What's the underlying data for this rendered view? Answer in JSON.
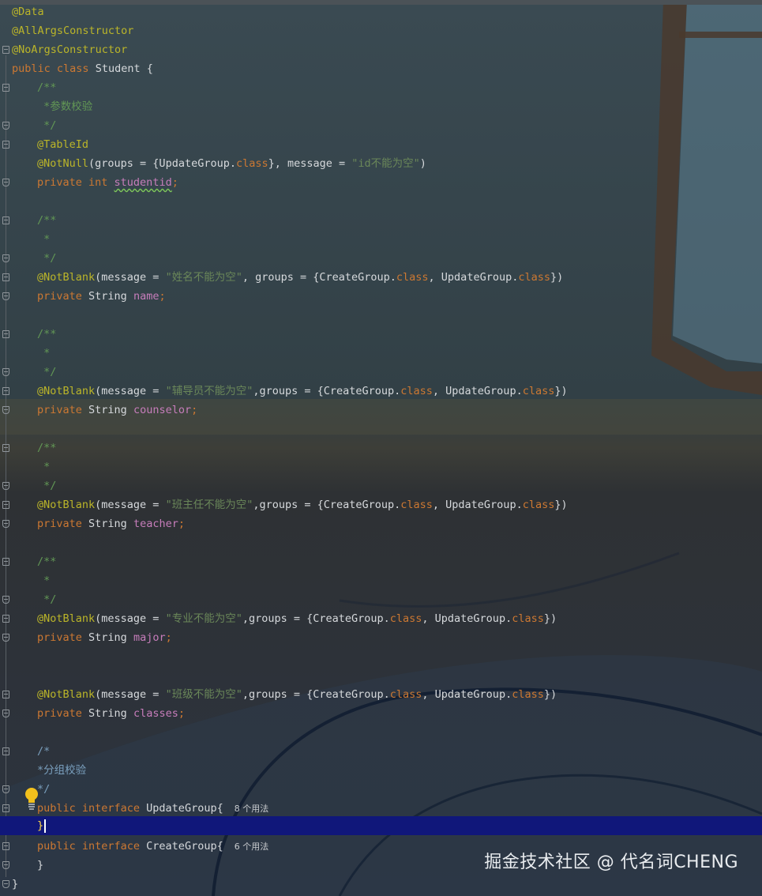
{
  "editor": {
    "lines": {
      "l0": "@Data",
      "l1": "@AllArgsConstructor",
      "l2": "@NoArgsConstructor",
      "l3_kw1": "public",
      "l3_kw2": "class",
      "l3_name": "Student {",
      "l4": "/**",
      "l5": " *参数校验",
      "l6": " */",
      "l7": "@TableId",
      "l8_ann": "@NotNull",
      "l8_a": "(groups = {UpdateGroup.",
      "l8_cls": "class",
      "l8_b": "}, message = ",
      "l8_str": "\"id不能为空\"",
      "l8_c": ")",
      "l9_kw": "private int ",
      "l9_fld": "studentid",
      "l9_end": ";",
      "l11": "/**",
      "l12": " *",
      "l13": " */",
      "l14_ann": "@NotBlank",
      "l14_a": "(message = ",
      "l14_str": "\"姓名不能为空\"",
      "l14_b": ", groups = {CreateGroup.",
      "l14_cls1": "class",
      "l14_c": ", UpdateGroup.",
      "l14_cls2": "class",
      "l14_d": "})",
      "l15_kw": "private ",
      "l15_type": "String ",
      "l15_fld": "name",
      "l15_end": ";",
      "l17": "/**",
      "l18": " *",
      "l19": " */",
      "l20_ann": "@NotBlank",
      "l20_a": "(message = ",
      "l20_str": "\"辅导员不能为空\"",
      "l20_b": ",groups = {CreateGroup.",
      "l20_cls1": "class",
      "l20_c": ", UpdateGroup.",
      "l20_cls2": "class",
      "l20_d": "})",
      "l21_kw": "private ",
      "l21_type": "String ",
      "l21_fld": "counselor",
      "l21_end": ";",
      "l23": "/**",
      "l24": " *",
      "l25": " */",
      "l26_ann": "@NotBlank",
      "l26_a": "(message = ",
      "l26_str": "\"班主任不能为空\"",
      "l26_b": ",groups = {CreateGroup.",
      "l26_cls1": "class",
      "l26_c": ", UpdateGroup.",
      "l26_cls2": "class",
      "l26_d": "})",
      "l27_kw": "private ",
      "l27_type": "String ",
      "l27_fld": "teacher",
      "l27_end": ";",
      "l29": "/**",
      "l30": " *",
      "l31": " */",
      "l32_ann": "@NotBlank",
      "l32_a": "(message = ",
      "l32_str": "\"专业不能为空\"",
      "l32_b": ",groups = {CreateGroup.",
      "l32_cls1": "class",
      "l32_c": ", UpdateGroup.",
      "l32_cls2": "class",
      "l32_d": "})",
      "l33_kw": "private ",
      "l33_type": "String ",
      "l33_fld": "major",
      "l33_end": ";",
      "l36_ann": "@NotBlank",
      "l36_a": "(message = ",
      "l36_str": "\"班级不能为空\"",
      "l36_b": ",groups = {CreateGroup.",
      "l36_cls1": "class",
      "l36_c": ", UpdateGroup.",
      "l36_cls2": "class",
      "l36_d": "})",
      "l37_kw": "private ",
      "l37_type": "String ",
      "l37_fld": "classes",
      "l37_end": ";",
      "l39": "/*",
      "l40": "*分组校验",
      "l41": "*/",
      "l42_kw": "public interface ",
      "l42_name": "UpdateGroup{",
      "l42_hint": "8 个用法",
      "l43": "}",
      "l44_kw": "public interface ",
      "l44_name": "CreateGroup{",
      "l44_hint": "6 个用法",
      "l45": "}",
      "l46": "}"
    }
  },
  "watermark": "掘金技术社区 @ 代名词CHENG",
  "colors": {
    "annotation": "#bbb529",
    "keyword": "#cc7832",
    "field": "#c77dbb",
    "string": "#6a8759",
    "doc_comment": "#629755",
    "current_line": "#10177a"
  },
  "icons": [
    "fold-marker-icon",
    "lightbulb-icon"
  ]
}
